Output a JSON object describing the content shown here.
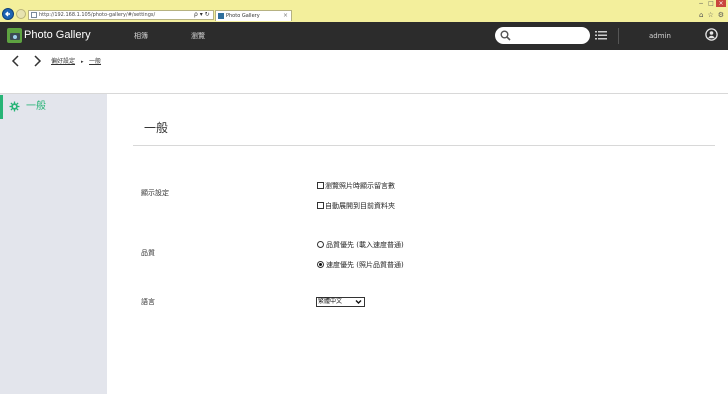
{
  "browser": {
    "address": "http://192.168.1.105/photo-gallery/#/settings/",
    "tab_title": "Photo Gallery",
    "tab_close": "×",
    "address_tools": "ρ ▾ ↻"
  },
  "app": {
    "title": "Photo Gallery",
    "menu": [
      "相簿",
      "瀏覽"
    ],
    "user": "admin"
  },
  "breadcrumb": {
    "items": [
      "偏好設定",
      "一般"
    ],
    "separator": "▸"
  },
  "sidebar": {
    "active_item": {
      "label": "一般",
      "icon": "gear-icon"
    }
  },
  "colors": {
    "accent": "#27b476",
    "header": "#2c2c2c",
    "sidebar": "#e3e5ec"
  },
  "content": {
    "title": "一般",
    "display": {
      "label": "顯示設定",
      "options": [
        {
          "label": "瀏覽照片時顯示留言數",
          "checked": false
        },
        {
          "label": "自動展開到目前資料夾",
          "checked": false
        }
      ]
    },
    "quality": {
      "label": "品質",
      "options": [
        {
          "label": "品質優先 (載入速度普通)",
          "selected": false
        },
        {
          "label": "速度優先 (照片品質普通)",
          "selected": true
        }
      ]
    },
    "language": {
      "label": "語言",
      "selected": "繁體中文"
    }
  }
}
